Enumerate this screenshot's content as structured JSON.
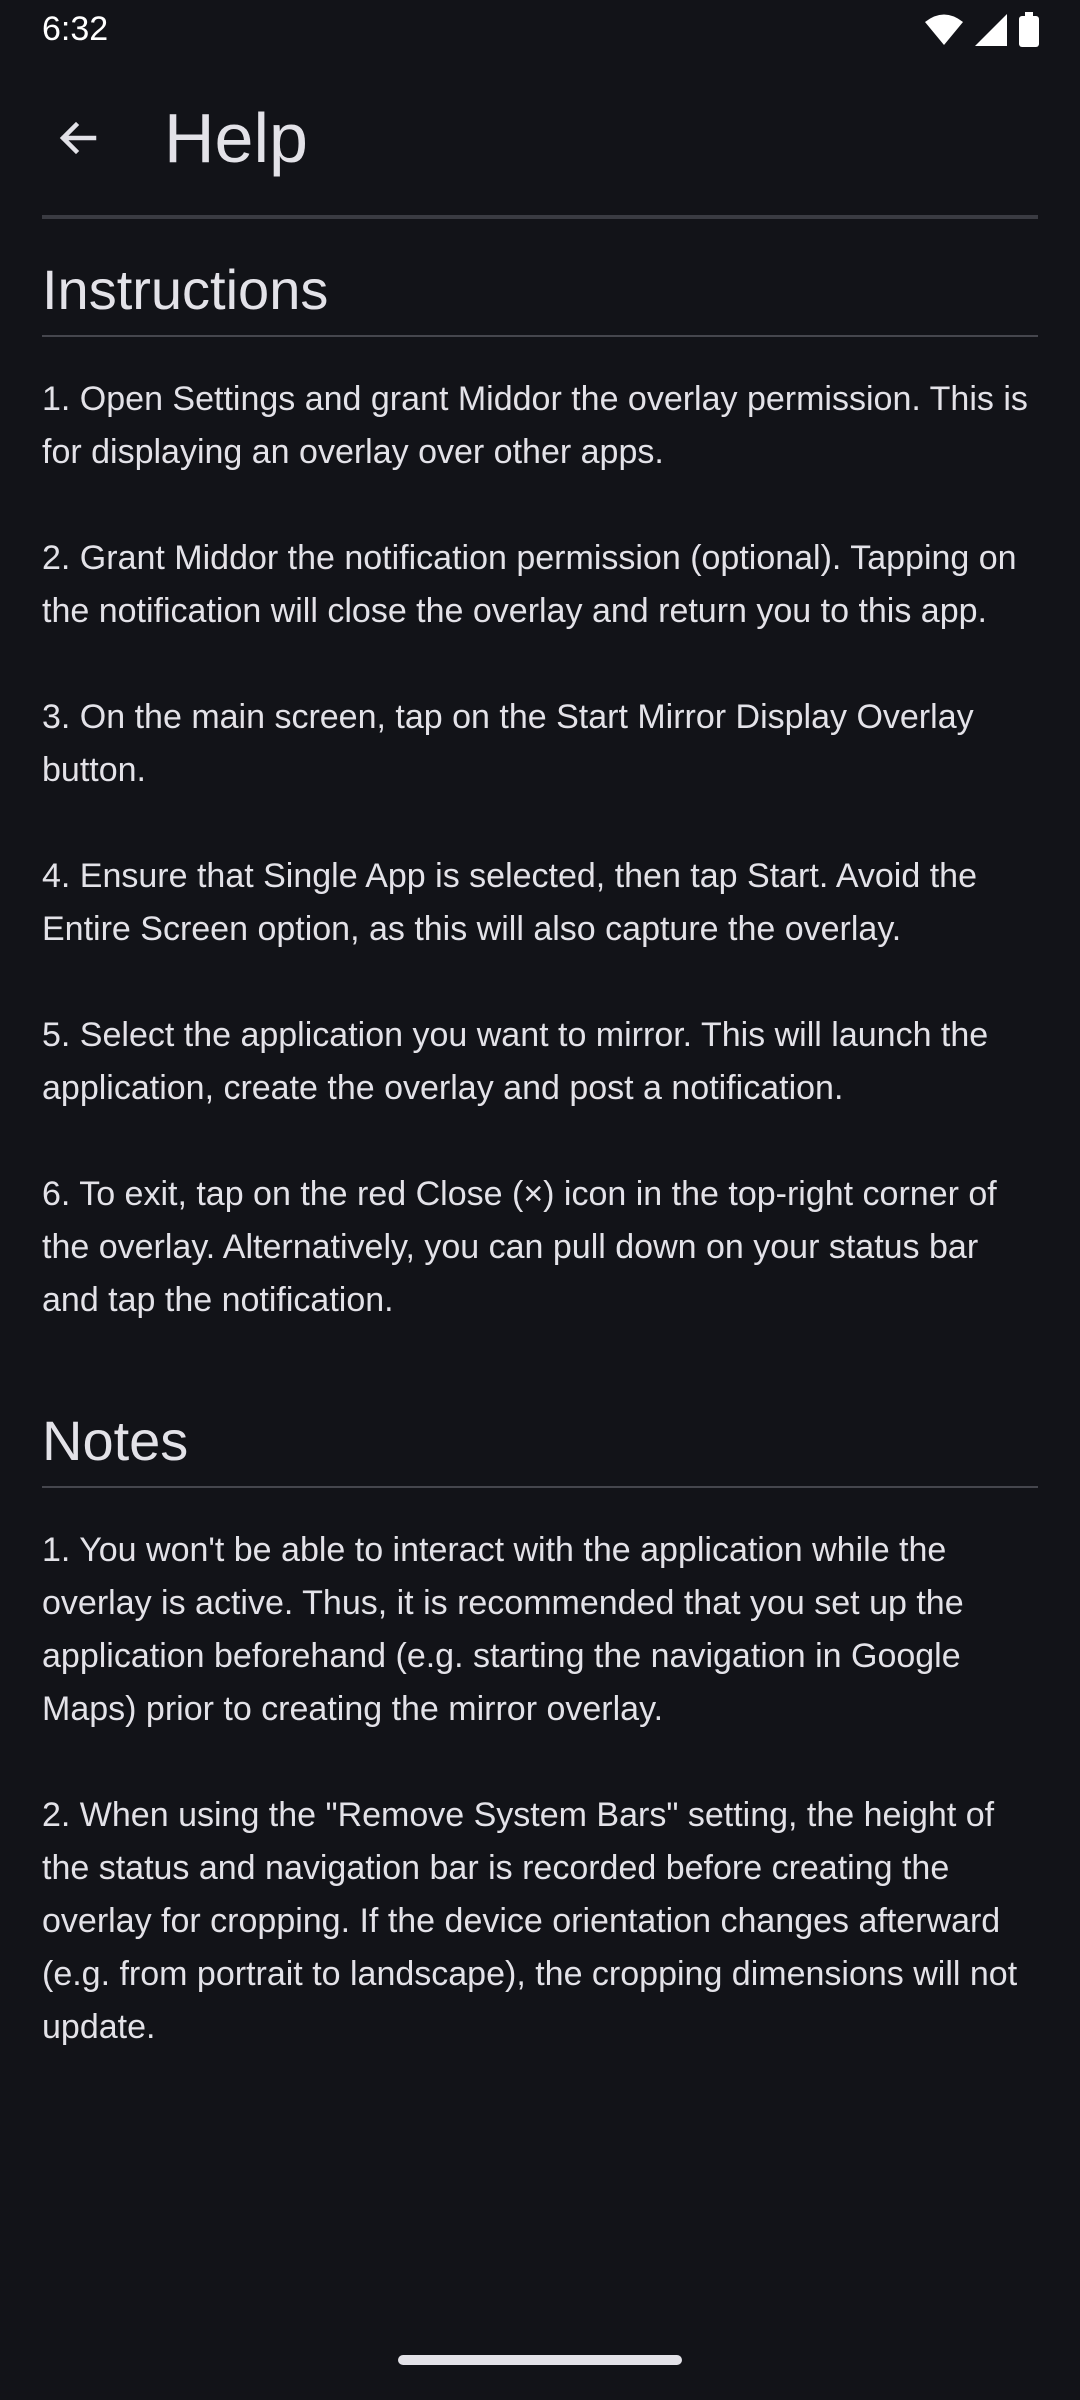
{
  "status_bar": {
    "time": "6:32",
    "icons": [
      "wifi-icon",
      "signal-icon",
      "battery-icon"
    ]
  },
  "app_bar": {
    "title": "Help",
    "back_icon": "arrow-left-icon"
  },
  "instructions": {
    "title": "Instructions",
    "items": [
      "1. Open Settings and grant Middor the overlay permission. This is for displaying an overlay over other apps.",
      "2. Grant Middor the notification permission (optional). Tapping on the notification will close the overlay and return you to this app.",
      "3. On the main screen, tap on the Start Mirror Display Overlay button.",
      "4. Ensure that Single App is selected, then tap Start. Avoid the Entire Screen option, as this will also capture the overlay.",
      "5. Select the application you want to mirror. This will launch the application, create the overlay and post a notification.",
      "6. To exit, tap on the red Close (×) icon in the top-right corner of the overlay. Alternatively, you can pull down on your status bar and tap the notification."
    ]
  },
  "notes": {
    "title": "Notes",
    "items": [
      "1. You won't be able to interact with the application while the overlay is active. Thus, it is recommended that you set up the application beforehand (e.g. starting the navigation in Google Maps) prior to creating the mirror overlay.",
      "2. When using the \"Remove System Bars\" setting, the height of the status and navigation bar is recorded before creating the overlay for cropping. If the device orientation changes afterward (e.g. from portrait to landscape), the cropping dimensions will not update."
    ]
  },
  "colors": {
    "background": "#121318",
    "text": "#e3e2e8",
    "divider": "#45464d"
  }
}
